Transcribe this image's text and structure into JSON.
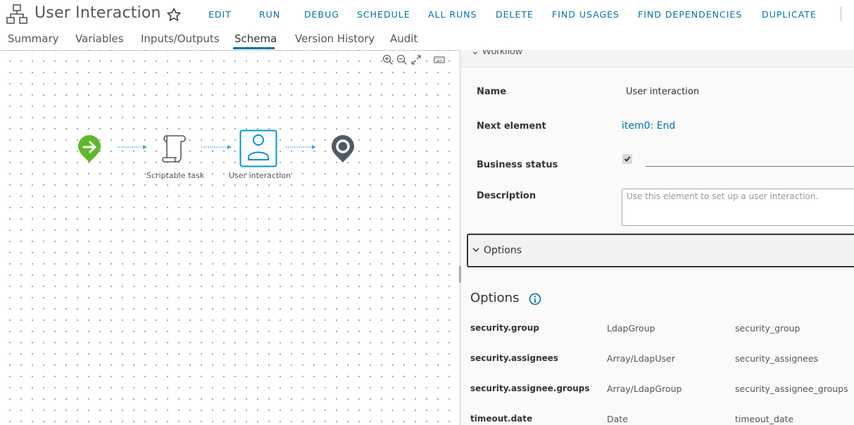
{
  "header": {
    "title": "User Interaction",
    "actions": [
      "EDIT",
      "RUN",
      "DEBUG",
      "SCHEDULE",
      "ALL RUNS",
      "DELETE",
      "FIND USAGES",
      "FIND DEPENDENCIES",
      "DUPLICATE"
    ]
  },
  "tabs": [
    "Summary",
    "Variables",
    "Inputs/Outputs",
    "Schema",
    "Version History",
    "Audit"
  ],
  "active_tab": "Schema",
  "canvas": {
    "nodes": {
      "start": "",
      "scriptable": "Scriptable task",
      "user": "User interaction",
      "end": ""
    },
    "tools": [
      "zoom-in-icon",
      "zoom-out-icon",
      "fullscreen-icon",
      "keyboard-icon"
    ]
  },
  "panel": {
    "section_header": "Workflow",
    "name_label": "Name",
    "name_value": "User interaction",
    "next_label": "Next element",
    "next_value": "item0: End",
    "status_label": "Business status",
    "status_checked": true,
    "desc_label": "Description",
    "desc_placeholder": "Use this element to set up a user interaction.",
    "options_bar": "Options",
    "options_title": "Options",
    "options_rows": [
      {
        "key": "security.group",
        "type": "LdapGroup",
        "binding": "security_group"
      },
      {
        "key": "security.assignees",
        "type": "Array/LdapUser",
        "binding": "security_assignees"
      },
      {
        "key": "security.assignee.groups",
        "type": "Array/LdapGroup",
        "binding": "security_assignee_groups"
      },
      {
        "key": "timeout.date",
        "type": "Date",
        "binding": "timeout_date"
      }
    ]
  },
  "colors": {
    "accent": "#0072a3",
    "start_green": "#5fb82b",
    "end_gray": "#4f5a63"
  }
}
